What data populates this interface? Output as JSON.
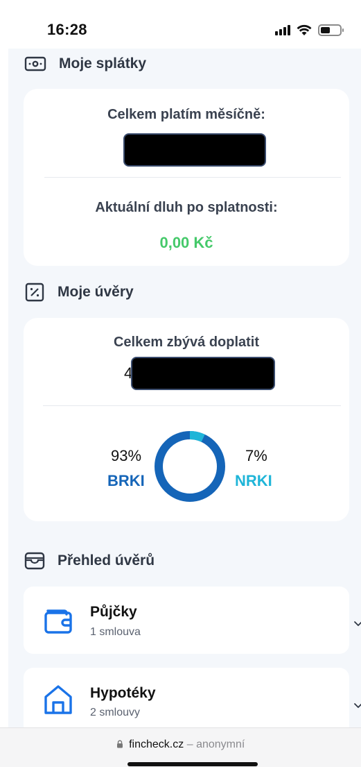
{
  "status_bar": {
    "time": "16:28"
  },
  "payments": {
    "title": "Moje splátky",
    "icon": "banknote-icon",
    "monthly_label": "Celkem platím měsíčně:",
    "overdue_label": "Aktuální dluh po splatnosti:",
    "overdue_value": "0,00 Kč"
  },
  "loans": {
    "title": "Moje úvěry",
    "icon": "percent-icon",
    "remaining_label": "Celkem zbývá doplatit",
    "remaining_visible_prefix": "4",
    "brki": {
      "percent": "93%",
      "label": "BRKI",
      "color": "#1565b8",
      "share": 0.93
    },
    "nrki": {
      "percent": "7%",
      "label": "NRKI",
      "color": "#1fb5d8",
      "share": 0.07
    }
  },
  "overview": {
    "title": "Přehled úvěrů",
    "icon": "wallet-outline-icon",
    "items": [
      {
        "title": "Půjčky",
        "subtitle": "1 smlouva",
        "icon": "wallet-icon"
      },
      {
        "title": "Hypotéky",
        "subtitle": "2 smlouvy",
        "icon": "house-icon"
      }
    ]
  },
  "browser": {
    "domain": "fincheck.cz",
    "separator": "–",
    "mode": "anonymní"
  },
  "colors": {
    "accent": "#1a73e8",
    "positive": "#45c96a",
    "text": "#2f3744"
  }
}
